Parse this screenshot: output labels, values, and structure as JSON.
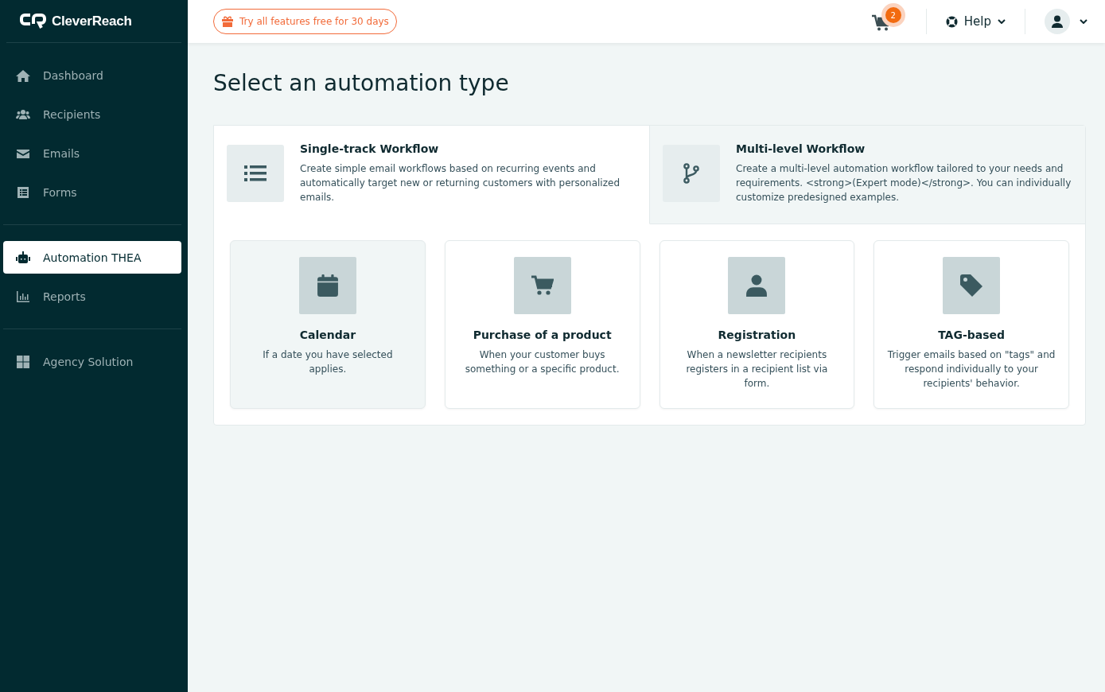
{
  "sidebar": {
    "logo": "CleverReach",
    "sections": [
      [
        {
          "label": "Dashboard",
          "selected": false
        },
        {
          "label": "Recipients",
          "selected": false
        },
        {
          "label": "Emails",
          "selected": false
        },
        {
          "label": "Forms",
          "selected": false
        }
      ],
      [
        {
          "label": "Automation THEA",
          "selected": true
        },
        {
          "label": "Reports",
          "selected": false
        }
      ],
      [
        {
          "label": "Agency Solution",
          "selected": false
        }
      ]
    ]
  },
  "topbar": {
    "trial_button": "Try all features free for 30 days",
    "cart_count": "2",
    "help": "Help"
  },
  "page_title": "Select an automation type",
  "tabs": [
    {
      "title": "Single-track Workflow",
      "description": "Create simple email workflows based on recurring events and automatically target new or returning customers with personalized emails.",
      "selected": true
    },
    {
      "title": "Multi-level Workflow",
      "description": "Create a multi-level automation workflow tailored to your needs and requirements. <strong>(Expert mode)</strong>. You can individually customize predesigned examples.",
      "selected": false
    }
  ],
  "cards": [
    {
      "title": "Calendar",
      "description": "If a date you have selected applies.",
      "selected": true
    },
    {
      "title": "Purchase of a product",
      "description": "When your customer buys something or a specific product.",
      "selected": false
    },
    {
      "title": "Registration",
      "description": "When a newsletter recipients registers in a recipient list via form.",
      "selected": false
    },
    {
      "title": "TAG-based",
      "description": "Trigger emails based on \"tags\" and respond individually to your recipients' behavior.",
      "selected": false
    }
  ]
}
